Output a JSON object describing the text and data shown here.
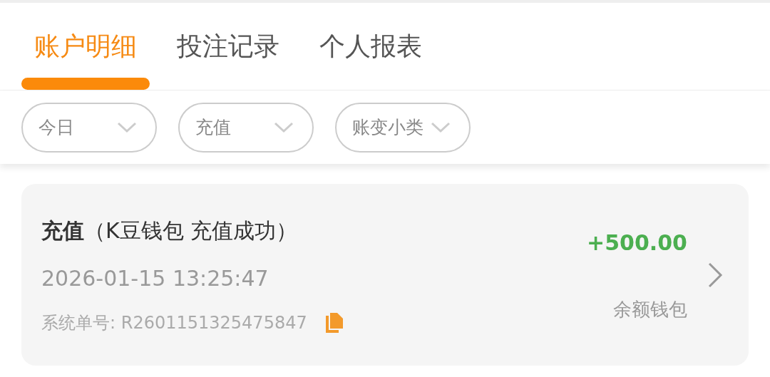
{
  "tabs": [
    {
      "label": "账户明细",
      "selected": true
    },
    {
      "label": "投注记录",
      "selected": false
    },
    {
      "label": "个人报表",
      "selected": false
    }
  ],
  "filters": [
    {
      "label": "今日"
    },
    {
      "label": "充值"
    },
    {
      "label": "账变小类"
    }
  ],
  "records": [
    {
      "title": "**充值**（K豆钱包 充值成功）",
      "time": "2026-01-15 13:25:47",
      "order": "系统单号: R2601151325475847",
      "amount": "+500.00",
      "wallet": "余额钱包"
    }
  ]
}
